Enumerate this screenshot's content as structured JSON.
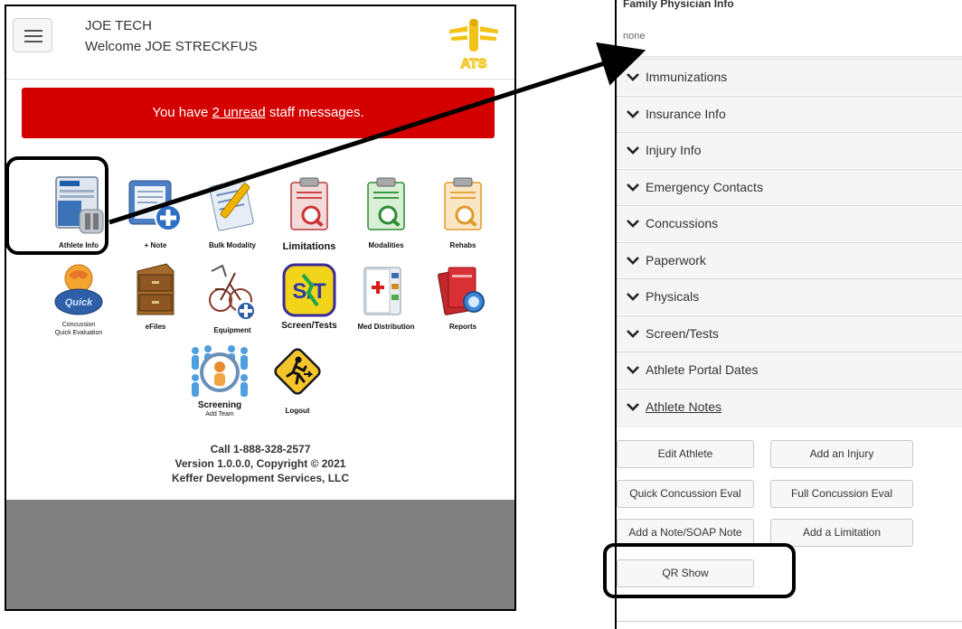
{
  "header": {
    "user_name": "JOE TECH",
    "welcome": "Welcome JOE STRECKFUS",
    "logo_text": "ATS"
  },
  "alert": {
    "prefix": "You have ",
    "link": "2 unread",
    "suffix": " staff messages."
  },
  "tiles": [
    {
      "label": "Athlete Info",
      "icon": "athlete-info-icon"
    },
    {
      "label": "+ Note",
      "icon": "note-icon"
    },
    {
      "label": "Bulk Modality",
      "icon": "bulk-modality-icon"
    },
    {
      "label": "Limitations",
      "icon": "limitations-icon"
    },
    {
      "label": "Modalities",
      "icon": "modalities-icon"
    },
    {
      "label": "Rehabs",
      "icon": "rehabs-icon"
    },
    {
      "label": "Concussion",
      "sublabel": "Quick Evaluation",
      "icon": "concussion-icon"
    },
    {
      "label": "eFiles",
      "icon": "efiles-icon"
    },
    {
      "label": "Equipment",
      "icon": "equipment-icon"
    },
    {
      "label": "Screen/Tests",
      "icon": "screen-tests-icon"
    },
    {
      "label": "Med Distribution",
      "icon": "med-distribution-icon"
    },
    {
      "label": "Reports",
      "icon": "reports-icon"
    },
    {
      "label": "Screening",
      "sublabel": "Add Team",
      "icon": "screening-icon"
    },
    {
      "label": "Logout",
      "icon": "logout-icon"
    }
  ],
  "footer": {
    "phone": "Call 1-888-328-2577",
    "version": "Version 1.0.0.0, Copyright © 2021",
    "company": "Keffer Development Services, LLC"
  },
  "right": {
    "family_title": "Family Physician Info",
    "family_value": "none",
    "sections": [
      "Immunizations",
      "Insurance Info",
      "Injury Info",
      "Emergency Contacts",
      "Concussions",
      "Paperwork",
      "Physicals",
      "Screen/Tests",
      "Athlete Portal Dates",
      "Athlete Notes"
    ],
    "buttons": {
      "edit_athlete": "Edit Athlete",
      "add_injury": "Add an Injury",
      "quick_concussion": "Quick Concussion Eval",
      "full_concussion": "Full Concussion Eval",
      "add_note": "Add a Note/SOAP Note",
      "add_limitation": "Add a Limitation",
      "qr_show": "QR Show"
    }
  },
  "colors": {
    "alert_red": "#d40000",
    "footer_gray": "#808080",
    "accordion_bg": "#f5f5f5",
    "logo_yellow": "#f2c318"
  }
}
